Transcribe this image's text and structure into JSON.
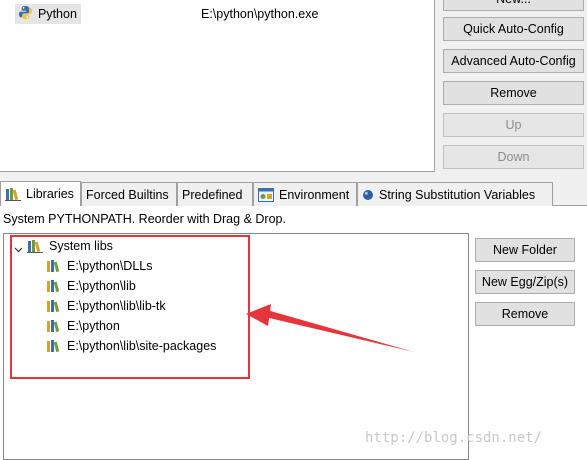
{
  "interpreters": {
    "rows": [
      {
        "name": "Python",
        "executable": "E:\\python\\python.exe",
        "icon": "python-icon"
      }
    ]
  },
  "interpreter_buttons": {
    "new_partial": "New...",
    "quick_auto_config": "Quick Auto-Config",
    "advanced_auto_config": "Advanced Auto-Config",
    "remove": "Remove",
    "up": "Up",
    "down": "Down"
  },
  "tabs": [
    {
      "label": "Libraries",
      "icon": "libraries-icon",
      "active": true
    },
    {
      "label": "Forced Builtins",
      "active": false
    },
    {
      "label": "Predefined",
      "active": false
    },
    {
      "label": "Environment",
      "icon": "environment-icon",
      "active": false
    },
    {
      "label": "String Substitution Variables",
      "icon": "variable-icon",
      "active": false
    }
  ],
  "libraries": {
    "hint": "System PYTHONPATH.   Reorder with Drag & Drop.",
    "root_label": "System libs",
    "paths": [
      "E:\\python\\DLLs",
      "E:\\python\\lib",
      "E:\\python\\lib\\lib-tk",
      "E:\\python",
      "E:\\python\\lib\\site-packages"
    ]
  },
  "library_buttons": {
    "new_folder": "New Folder",
    "new_egg_zip": "New Egg/Zip(s)",
    "remove": "Remove"
  },
  "annotation": {
    "color": "#e5343b"
  },
  "watermark": "http://blog.csdn.net/"
}
